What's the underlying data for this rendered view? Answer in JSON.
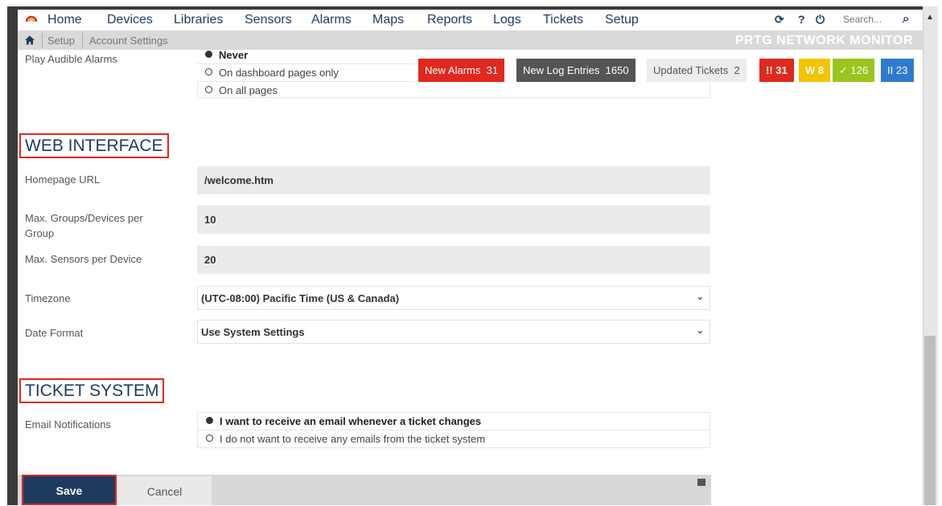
{
  "nav": {
    "items": [
      "Home",
      "Devices",
      "Libraries",
      "Sensors",
      "Alarms",
      "Maps",
      "Reports",
      "Logs",
      "Tickets",
      "Setup"
    ],
    "search_placeholder": "Search...",
    "tools": {
      "refresh": "⟳",
      "help": "?",
      "logout": "⏻"
    }
  },
  "breadcrumb": {
    "items": [
      "Setup",
      "Account Settings"
    ],
    "brand": "PRTG NETWORK MONITOR"
  },
  "alarms_setting": {
    "label": "Play Audible Alarms",
    "options": [
      "Never",
      "On dashboard pages only",
      "On all pages"
    ],
    "selected": 0
  },
  "badges": {
    "new_alarms": {
      "label": "New Alarms",
      "count": "31",
      "color": "#e0281f"
    },
    "new_log": {
      "label": "New Log Entries",
      "count": "1650",
      "color": "#555555"
    },
    "updated_tickets": {
      "label": "Updated Tickets",
      "count": "2",
      "color": "#ececec"
    },
    "down": {
      "label": "!! 31",
      "color": "#e0281f"
    },
    "warning": {
      "label": "W 8",
      "color": "#f5c400"
    },
    "up": {
      "label": "✓ 126",
      "color": "#9bc41c"
    },
    "paused": {
      "label": "II 23",
      "color": "#2d7bd1"
    }
  },
  "web_interface": {
    "title": "WEB INTERFACE",
    "homepage_label": "Homepage URL",
    "homepage_value": "/welcome.htm",
    "max_groups_label": "Max. Groups/Devices per Group",
    "max_groups_value": "10",
    "max_sensors_label": "Max. Sensors per Device",
    "max_sensors_value": "20",
    "timezone_label": "Timezone",
    "timezone_value": "(UTC-08:00) Pacific Time (US & Canada)",
    "date_format_label": "Date Format",
    "date_format_value": "Use System Settings"
  },
  "ticket_system": {
    "title": "TICKET SYSTEM",
    "email_label": "Email Notifications",
    "options": [
      "I want to receive an email whenever a ticket changes",
      "I do not want to receive any emails from the ticket system"
    ],
    "selected": 0
  },
  "footer": {
    "save_label": "Save",
    "cancel_label": "Cancel"
  }
}
